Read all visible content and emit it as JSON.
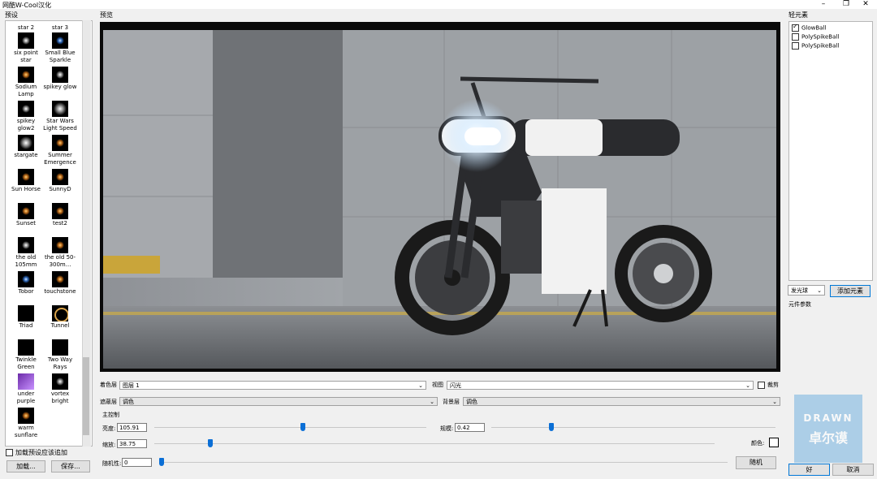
{
  "window": {
    "title": "网酷W-Cool汉化"
  },
  "presets": {
    "label": "预设",
    "items": [
      {
        "name": "star 2",
        "thumb": "white"
      },
      {
        "name": "star 3",
        "thumb": "white"
      },
      {
        "name": "six point star",
        "thumb": "white"
      },
      {
        "name": "Small Blue Sparkle",
        "thumb": "blue"
      },
      {
        "name": "Sodium Lamp",
        "thumb": "warm"
      },
      {
        "name": "spikey glow",
        "thumb": "white"
      },
      {
        "name": "spikey glow2",
        "thumb": "white"
      },
      {
        "name": "Star Wars Light Speed",
        "thumb": "big"
      },
      {
        "name": "stargate",
        "thumb": "big"
      },
      {
        "name": "Summer Emergence",
        "thumb": "warm"
      },
      {
        "name": "Sun Horse",
        "thumb": "warm"
      },
      {
        "name": "SunnyD",
        "thumb": "warm"
      },
      {
        "name": "Sunset",
        "thumb": "warm"
      },
      {
        "name": "test2",
        "thumb": "warm"
      },
      {
        "name": "the old 105mm",
        "thumb": "white"
      },
      {
        "name": "the old 50-300m...",
        "thumb": "warm"
      },
      {
        "name": "Tobor",
        "thumb": "blue"
      },
      {
        "name": "touchstone",
        "thumb": "warm"
      },
      {
        "name": "Triad",
        "thumb": "black"
      },
      {
        "name": "Tunnel",
        "thumb": "ring"
      },
      {
        "name": "Twinkle Green",
        "thumb": "black"
      },
      {
        "name": "Two Way Rays",
        "thumb": "black"
      },
      {
        "name": "under purple",
        "thumb": "purple"
      },
      {
        "name": "vortex bright",
        "thumb": "white"
      },
      {
        "name": "warm sunflare",
        "thumb": "warm"
      }
    ],
    "add_to_existing_label": "加载预设应该追加",
    "load_button": "加载...",
    "save_button": "保存..."
  },
  "preview": {
    "label": "预览"
  },
  "controls": {
    "color_layer_label": "着色层",
    "color_layer_value": "图层 1",
    "view_label": "视图",
    "view_value": "闪光",
    "clip_label": "裁剪",
    "mask_layer_label": "遮蔽层",
    "mask_layer_value": "调色",
    "bg_layer_label": "背景层",
    "bg_layer_value": "调色",
    "main_controls_label": "主控制",
    "brightness_label": "亮度:",
    "brightness_value": "105.91",
    "brightness_level": 0.5,
    "scale_label": "规模:",
    "scale_value": "0.42",
    "scale_level": 0.21,
    "zoom_label": "缩放:",
    "zoom_value": "38.75",
    "zoom_level": 0.1,
    "color_label": "颜色:",
    "randomness_label": "随机性:",
    "randomness_value": "0",
    "randomness_level": 0.0,
    "random_button": "随机"
  },
  "elements": {
    "label": "轻元素",
    "items": [
      {
        "name": "GlowBall",
        "checked": true
      },
      {
        "name": "PolySpikeBall",
        "checked": false
      },
      {
        "name": "PolySpikeBall",
        "checked": false
      }
    ],
    "type_select": "发光球",
    "add_button": "添加元素",
    "params_label": "元件参数"
  },
  "dialog": {
    "ok_button": "好",
    "cancel_button": "取消"
  },
  "watermark": {
    "line1": "DRAWN",
    "line2": "卓尔谟"
  },
  "colors": {
    "accent": "#0b6fd6",
    "headlight": "#e8f4ff"
  }
}
